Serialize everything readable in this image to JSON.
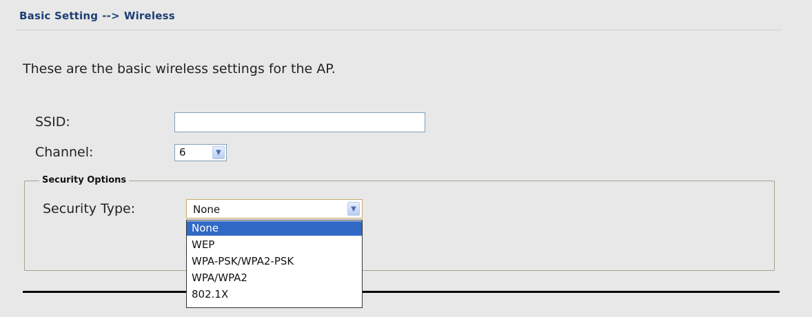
{
  "header": {
    "section": "Basic Setting",
    "separator": "-->",
    "page": "Wireless"
  },
  "intro_text": "These are the basic wireless settings for the AP.",
  "ssid": {
    "label": "SSID:",
    "value": ""
  },
  "channel": {
    "label": "Channel:",
    "value": "6"
  },
  "security": {
    "legend": "Security Options",
    "type_label": "Security Type:",
    "selected": "None",
    "options": [
      "None",
      "WEP",
      "WPA-PSK/WPA2-PSK",
      "WPA/WPA2",
      "802.1X"
    ]
  },
  "icons": {
    "dropdown_arrow": "chevron-down-icon"
  },
  "colors": {
    "background": "#e8e8e8",
    "breadcrumb": "#1d3f73",
    "highlight": "#3169c6"
  }
}
